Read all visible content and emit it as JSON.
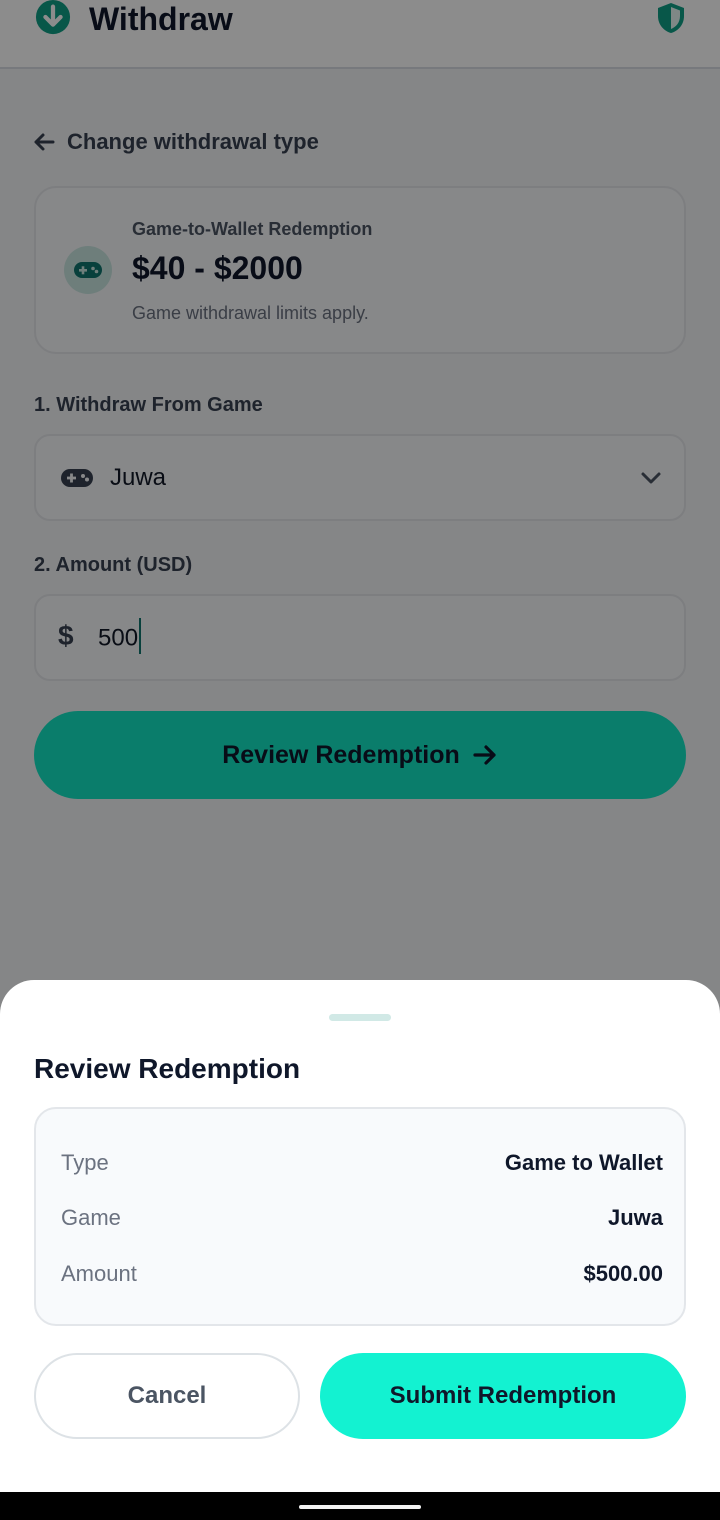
{
  "header": {
    "title": "Withdraw",
    "icon": "download-circle-icon",
    "security_icon": "shield-icon"
  },
  "back_link": {
    "label": "Change withdrawal type",
    "icon": "arrow-left-icon"
  },
  "limits_card": {
    "eyebrow": "Game-to-Wallet Redemption",
    "range": "$40 - $2000",
    "note": "Game withdrawal limits apply.",
    "icon": "gamepad-icon"
  },
  "form": {
    "game_label": "1. Withdraw From Game",
    "game_value": "Juwa",
    "amount_label": "2. Amount (USD)",
    "currency_symbol": "$",
    "amount_value": "500",
    "review_button": "Review Redemption"
  },
  "sheet": {
    "title": "Review Redemption",
    "rows": [
      {
        "key": "Type",
        "value": "Game to Wallet"
      },
      {
        "key": "Game",
        "value": "Juwa"
      },
      {
        "key": "Amount",
        "value": "$500.00"
      }
    ],
    "cancel_label": "Cancel",
    "submit_label": "Submit Redemption"
  },
  "colors": {
    "accent": "#13E3C4",
    "accent_bright": "#13F2D1",
    "brand_dark": "#0F766E"
  }
}
